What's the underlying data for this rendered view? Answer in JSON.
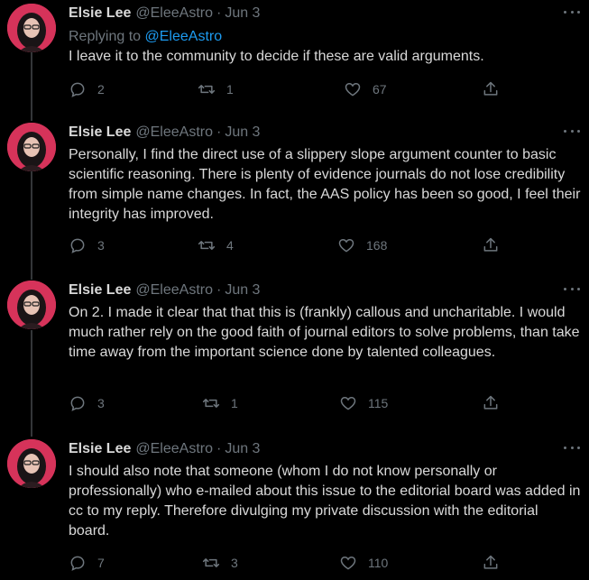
{
  "colors": {
    "background": "#000000",
    "text": "#d9d9d9",
    "muted": "#6e767d",
    "link": "#1d9bf0",
    "thread_line": "#333639"
  },
  "tweets": [
    {
      "name": "Elsie Lee",
      "handle": "@EleeAstro",
      "separator": "·",
      "date": "Jun 3",
      "replying_label": "Replying to",
      "replying_to": "@EleeAstro",
      "text": "I leave it to the community to decide if these are valid arguments.",
      "replies": "2",
      "retweets": "1",
      "likes": "67",
      "icons": {
        "reply": "reply-icon",
        "retweet": "retweet-icon",
        "like": "heart-icon",
        "share": "share-icon",
        "more": "more-icon"
      }
    },
    {
      "name": "Elsie Lee",
      "handle": "@EleeAstro",
      "separator": "·",
      "date": "Jun 3",
      "text": "Personally, I find the direct use of a slippery slope argument counter to basic scientific reasoning. There is plenty of evidence journals do not lose credibility from simple name changes. In fact, the AAS policy has been so good, I feel their integrity has improved.",
      "replies": "3",
      "retweets": "4",
      "likes": "168"
    },
    {
      "name": "Elsie Lee",
      "handle": "@EleeAstro",
      "separator": "·",
      "date": "Jun 3",
      "text": "On 2. I made it clear that that this is (frankly) callous and uncharitable. I would much rather rely on the good faith of journal editors to solve problems, than take time away from the important science done by talented colleagues.",
      "replies": "3",
      "retweets": "1",
      "likes": "115"
    },
    {
      "name": "Elsie Lee",
      "handle": "@EleeAstro",
      "separator": "·",
      "date": "Jun 3",
      "text": "I should also note that someone (whom I do not know personally or professionally) who e-mailed about this issue to the editorial board was added in cc to my reply. Therefore divulging my private discussion with the editorial board.",
      "replies": "7",
      "retweets": "3",
      "likes": "110"
    }
  ]
}
